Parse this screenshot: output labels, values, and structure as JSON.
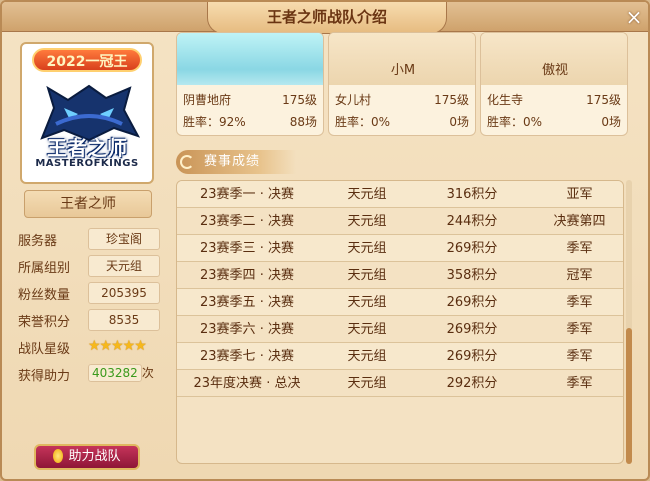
{
  "window": {
    "title": "王者之师战队介绍",
    "close_icon": "×"
  },
  "team": {
    "badge": "2022一冠王",
    "logo_cn": "王者之师",
    "logo_en": "MASTEROFKINGS",
    "name": "王者之师",
    "info": [
      {
        "label": "服务器",
        "value": "珍宝阁"
      },
      {
        "label": "所属组别",
        "value": "天元组"
      },
      {
        "label": "粉丝数量",
        "value": "205395"
      },
      {
        "label": "荣誉积分",
        "value": "8535"
      }
    ],
    "stars_label": "战队星级",
    "stars": 5,
    "boost_label": "获得助力",
    "boost_value": "403282",
    "boost_unit": "次",
    "boost_button": "助力战队"
  },
  "players": [
    {
      "top_name": "",
      "sect": "阴曹地府",
      "level": "175级",
      "win_label": "胜率：",
      "win_rate": "92%",
      "games": "88场"
    },
    {
      "top_name": "小M",
      "sect": "女儿村",
      "level": "175级",
      "win_label": "胜率：",
      "win_rate": "0%",
      "games": "0场"
    },
    {
      "top_name": "傲视",
      "sect": "化生寺",
      "level": "175级",
      "win_label": "胜率：",
      "win_rate": "0%",
      "games": "0场"
    }
  ],
  "results_title": "赛事成绩",
  "results": [
    {
      "event": "23赛季一 · 决赛",
      "group": "天元组",
      "points": "316积分",
      "rank": "亚军"
    },
    {
      "event": "23赛季二 · 决赛",
      "group": "天元组",
      "points": "244积分",
      "rank": "决赛第四"
    },
    {
      "event": "23赛季三 · 决赛",
      "group": "天元组",
      "points": "269积分",
      "rank": "季军"
    },
    {
      "event": "23赛季四 · 决赛",
      "group": "天元组",
      "points": "358积分",
      "rank": "冠军"
    },
    {
      "event": "23赛季五 · 决赛",
      "group": "天元组",
      "points": "269积分",
      "rank": "季军"
    },
    {
      "event": "23赛季六 · 决赛",
      "group": "天元组",
      "points": "269积分",
      "rank": "季军"
    },
    {
      "event": "23赛季七 · 决赛",
      "group": "天元组",
      "points": "269积分",
      "rank": "季军"
    },
    {
      "event": "23年度决赛 · 总决",
      "group": "天元组",
      "points": "292积分",
      "rank": "季军"
    }
  ]
}
